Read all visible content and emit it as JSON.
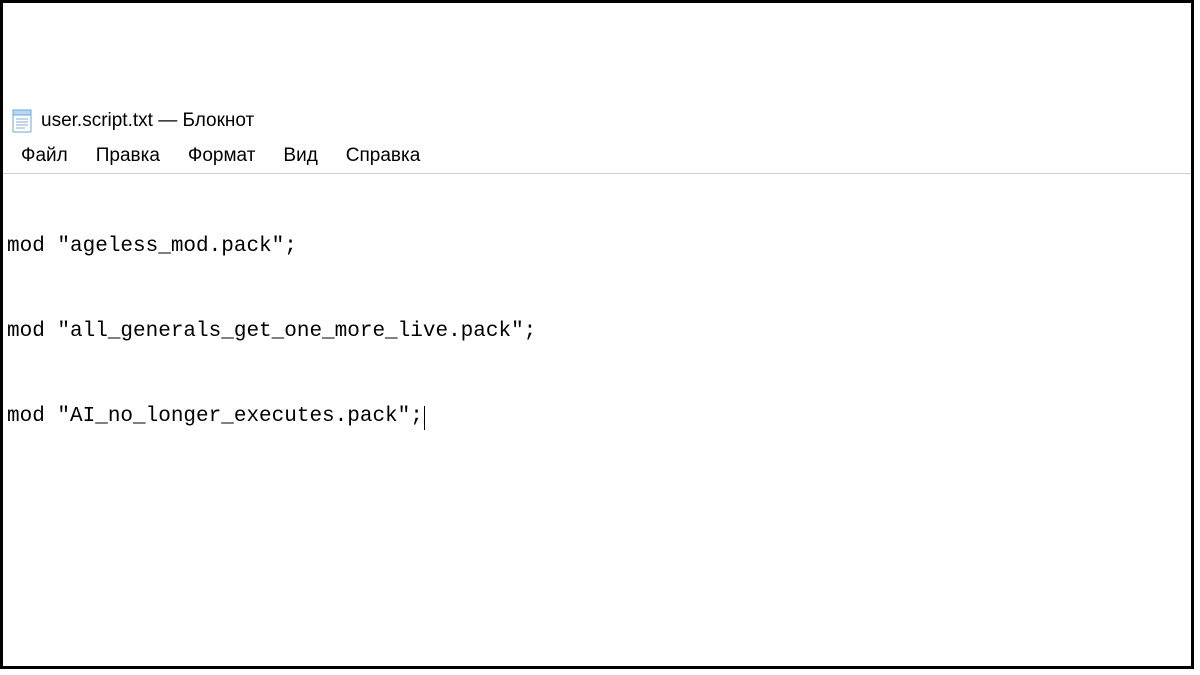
{
  "window": {
    "title": "user.script.txt — Блокнот"
  },
  "menu": {
    "items": [
      {
        "label": "Файл"
      },
      {
        "label": "Правка"
      },
      {
        "label": "Формат"
      },
      {
        "label": "Вид"
      },
      {
        "label": "Справка"
      }
    ]
  },
  "editor": {
    "lines": [
      "mod \"ageless_mod.pack\";",
      "mod \"all_generals_get_one_more_live.pack\";",
      "mod \"AI_no_longer_executes.pack\";"
    ],
    "cursor_line": 2
  }
}
